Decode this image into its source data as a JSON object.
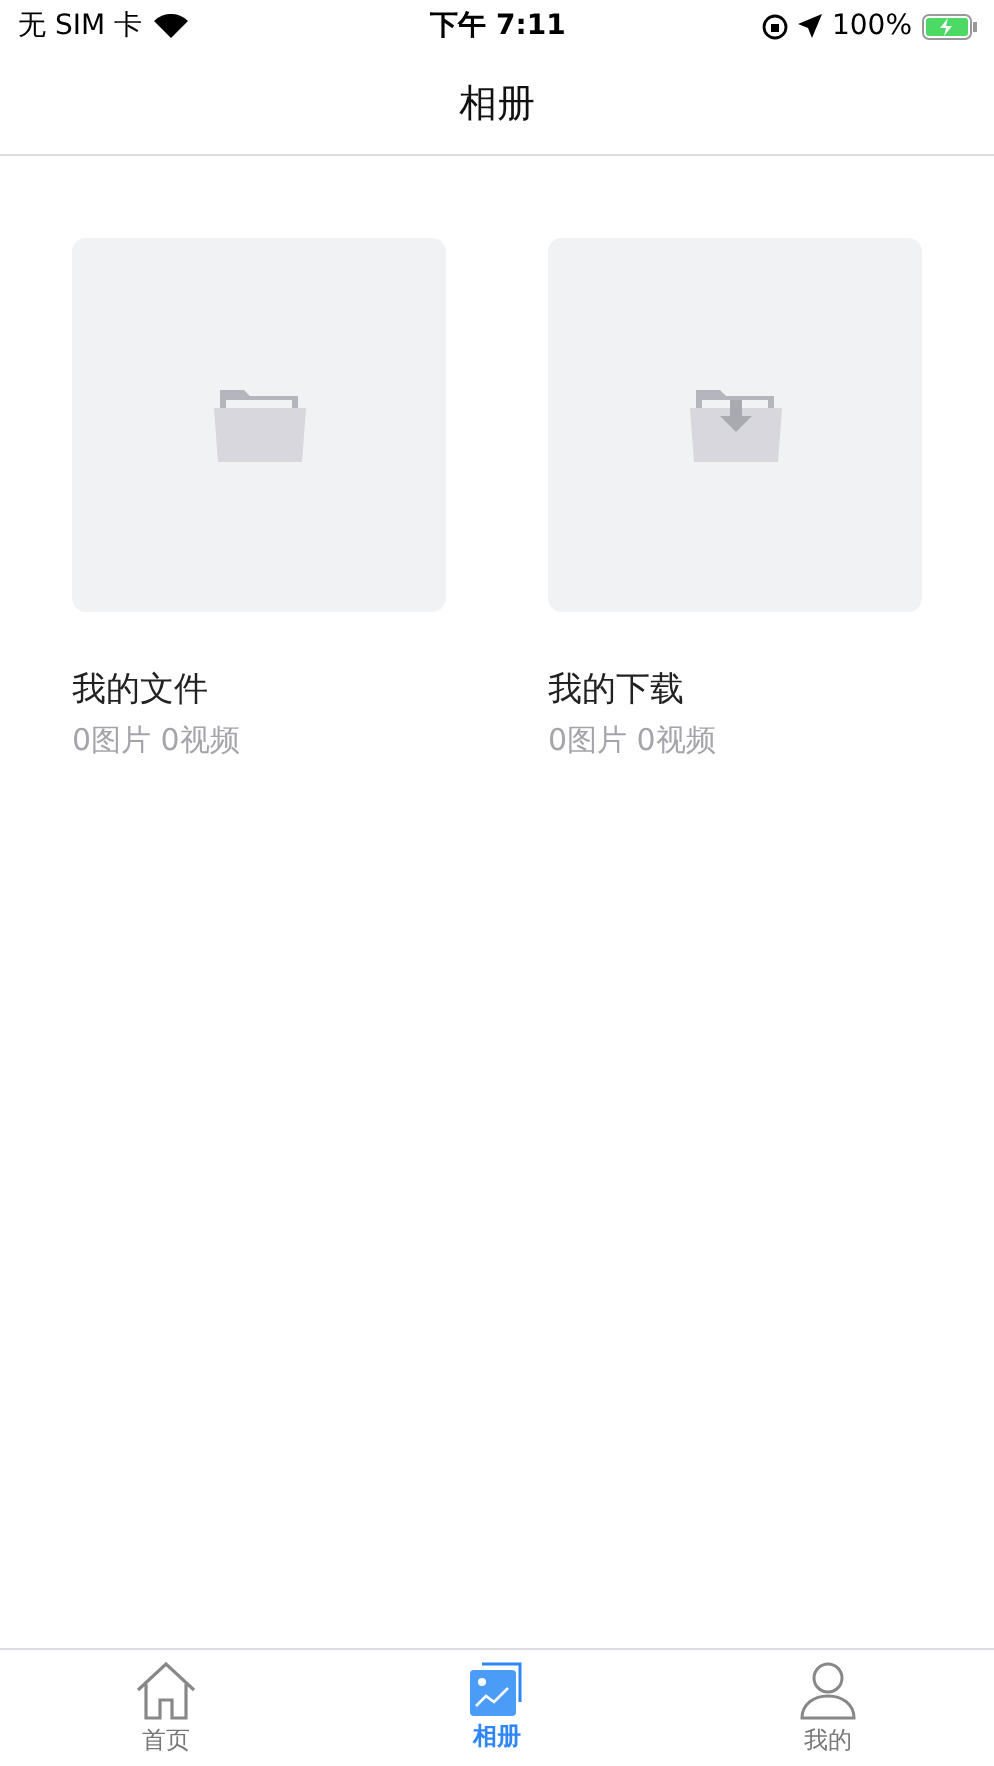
{
  "status_bar": {
    "carrier": "无 SIM 卡",
    "time": "下午 7:11",
    "battery": "100%"
  },
  "nav": {
    "title": "相册"
  },
  "albums": [
    {
      "kind": "folder",
      "name": "我的文件",
      "counts": "0图片 0视频"
    },
    {
      "kind": "download",
      "name": "我的下载",
      "counts": "0图片 0视频"
    }
  ],
  "tabs": [
    {
      "kind": "home",
      "label": "首页",
      "selected": false
    },
    {
      "kind": "album",
      "label": "相册",
      "selected": true
    },
    {
      "kind": "me",
      "label": "我的",
      "selected": false
    }
  ]
}
